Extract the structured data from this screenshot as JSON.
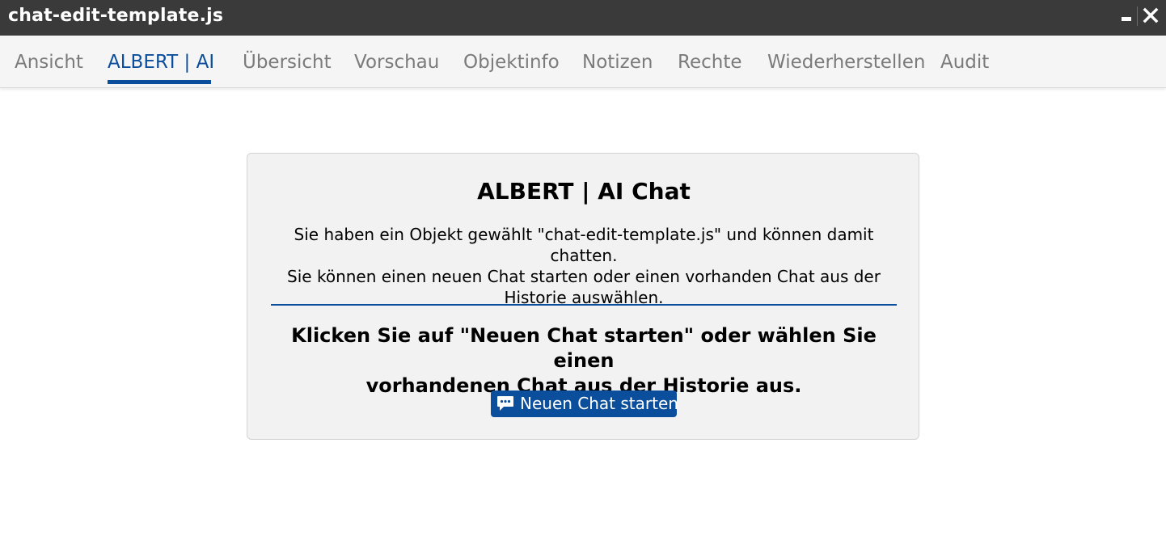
{
  "window": {
    "title": "chat-edit-template.js",
    "minimize_icon": "minimize-icon",
    "close_icon": "close-icon"
  },
  "tabs": [
    {
      "label": "Ansicht",
      "active": false
    },
    {
      "label": "ALBERT | AI",
      "active": true
    },
    {
      "label": "Übersicht",
      "active": false
    },
    {
      "label": "Vorschau",
      "active": false
    },
    {
      "label": "Objektinfo",
      "active": false
    },
    {
      "label": "Notizen",
      "active": false
    },
    {
      "label": "Rechte",
      "active": false
    },
    {
      "label": "Wiederherstellen",
      "active": false
    },
    {
      "label": "Audit",
      "active": false
    }
  ],
  "card": {
    "title": "ALBERT | AI Chat",
    "description_lines": [
      "Sie haben ein Objekt gewählt \"chat-edit-template.js\" und können damit chatten.",
      "Sie können einen neuen Chat starten oder einen vorhanden Chat aus der",
      "Historie auswählen."
    ],
    "instruction_lines": [
      "Klicken Sie auf \"Neuen Chat starten\" oder wählen Sie einen",
      "vorhandenen Chat aus der Historie aus."
    ],
    "button_label": "Neuen Chat starten",
    "button_icon": "chat-bubble-icon"
  },
  "colors": {
    "titlebar_bg": "#3a3a3a",
    "accent": "#0b4f9c",
    "tab_inactive": "#7b7b7b",
    "card_bg": "#f2f2f2"
  }
}
